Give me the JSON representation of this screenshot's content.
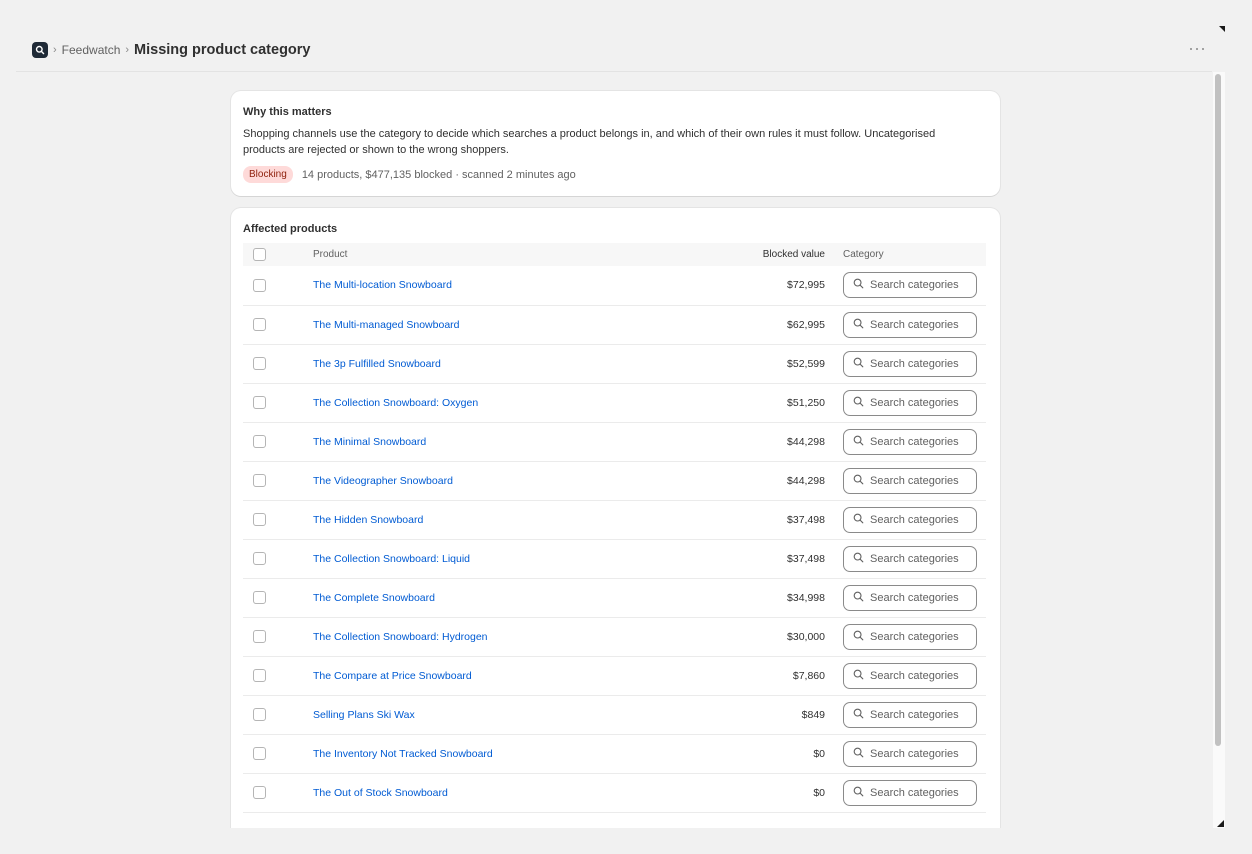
{
  "breadcrumb": {
    "app_icon": "search-icon",
    "parent": "Feedwatch",
    "title": "Missing product category"
  },
  "header": {
    "more_icon": "more-horizontal-icon"
  },
  "why_card": {
    "title": "Why this matters",
    "body": "Shopping channels use the category to decide which searches a product belongs in, and which of their own rules it must follow. Uncategorised products are rejected or shown to the wrong shoppers.",
    "badge": "Blocking",
    "meta": "14 products, $477,135 blocked · scanned 2 minutes ago"
  },
  "products_card": {
    "title": "Affected products",
    "columns": {
      "product": "Product",
      "blocked_value": "Blocked value",
      "category": "Category"
    },
    "category_placeholder": "Search categories",
    "rows": [
      {
        "product": "The Multi-location Snowboard",
        "value": "$72,995"
      },
      {
        "product": "The Multi-managed Snowboard",
        "value": "$62,995"
      },
      {
        "product": "The 3p Fulfilled Snowboard",
        "value": "$52,599"
      },
      {
        "product": "The Collection Snowboard: Oxygen",
        "value": "$51,250"
      },
      {
        "product": "The Minimal Snowboard",
        "value": "$44,298"
      },
      {
        "product": "The Videographer Snowboard",
        "value": "$44,298"
      },
      {
        "product": "The Hidden Snowboard",
        "value": "$37,498"
      },
      {
        "product": "The Collection Snowboard: Liquid",
        "value": "$37,498"
      },
      {
        "product": "The Complete Snowboard",
        "value": "$34,998"
      },
      {
        "product": "The Collection Snowboard: Hydrogen",
        "value": "$30,000"
      },
      {
        "product": "The Compare at Price Snowboard",
        "value": "$7,860"
      },
      {
        "product": "Selling Plans Ski Wax",
        "value": "$849"
      },
      {
        "product": "The Inventory Not Tracked Snowboard",
        "value": "$0"
      },
      {
        "product": "The Out of Stock Snowboard",
        "value": "$0"
      }
    ]
  },
  "colors": {
    "link": "#005bd3",
    "badge_bg": "#fedad9",
    "badge_text": "#8e1f0b",
    "page_bg": "#f1f1f1"
  }
}
